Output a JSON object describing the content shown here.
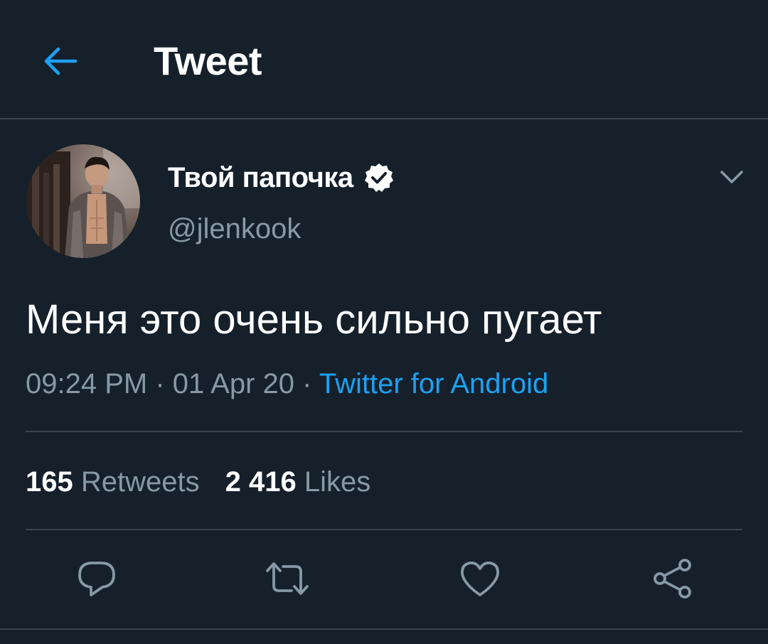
{
  "header": {
    "title": "Tweet",
    "back_icon": "back-arrow-icon",
    "accent_color": "#1da1f2"
  },
  "tweet": {
    "author": {
      "display_name": "Твой папочка",
      "handle": "@jlenkook",
      "verified": true
    },
    "text": "Меня это очень сильно пугает",
    "time": "09:24 PM",
    "date": "01 Apr 20",
    "separator": " · ",
    "source": "Twitter for Android"
  },
  "stats": {
    "retweets": {
      "count": "165",
      "label": "Retweets"
    },
    "likes": {
      "count": "2 416",
      "label": "Likes"
    }
  },
  "actions": {
    "reply_icon": "reply-icon",
    "retweet_icon": "retweet-icon",
    "like_icon": "like-icon",
    "share_icon": "share-icon"
  },
  "colors": {
    "background": "#15202b",
    "divider": "#38444d",
    "secondary_text": "#8899a6",
    "link": "#1da1f2"
  }
}
